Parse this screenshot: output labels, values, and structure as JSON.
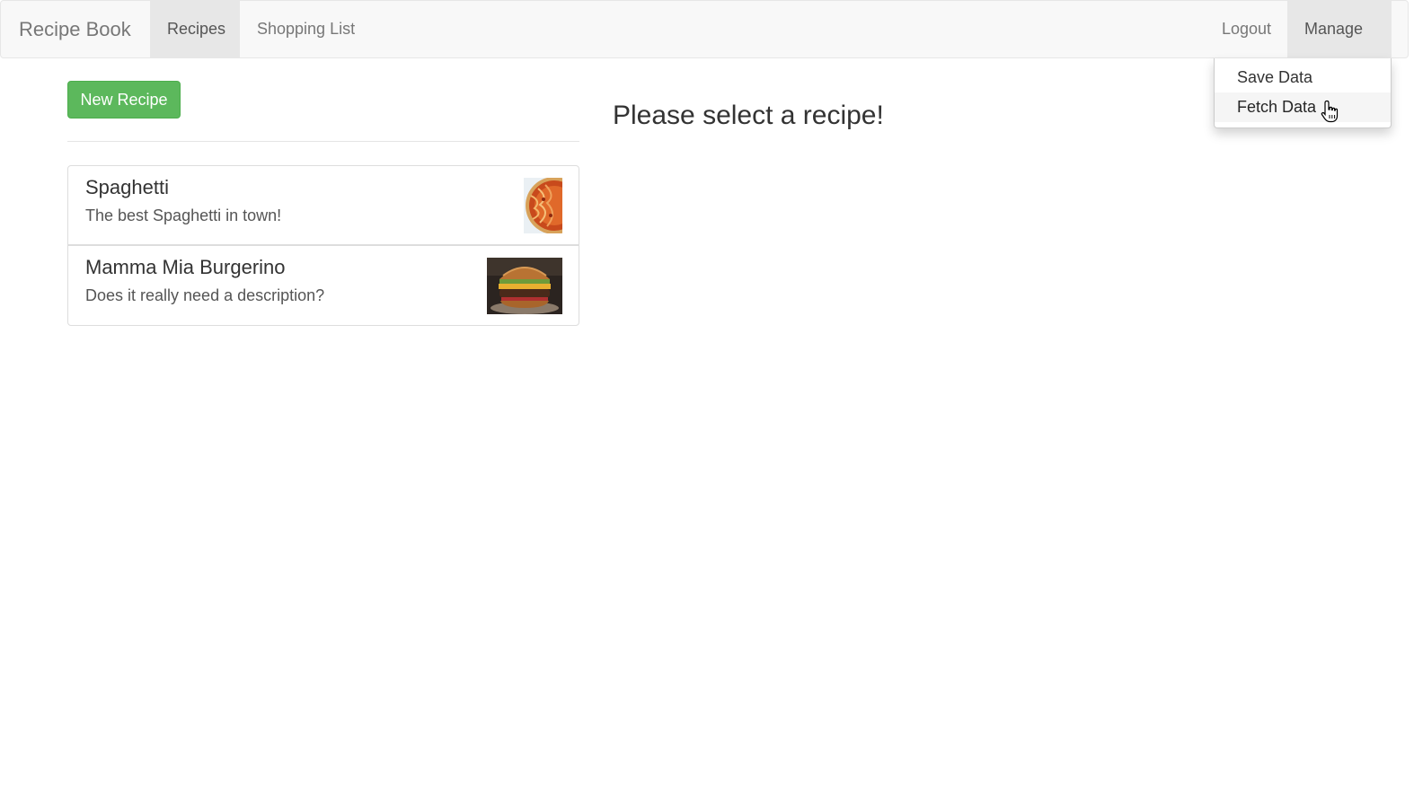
{
  "navbar": {
    "brand": "Recipe Book",
    "links": [
      "Recipes",
      "Shopping List"
    ],
    "active_link": "Recipes",
    "logout": "Logout",
    "manage": "Manage"
  },
  "manage_menu": {
    "items": [
      "Save Data",
      "Fetch Data"
    ],
    "hovered_item": "Fetch Data"
  },
  "recipes": {
    "new_button": "New Recipe",
    "list": [
      {
        "name": "Spaghetti",
        "description": "The best Spaghetti in town!"
      },
      {
        "name": "Mamma Mia Burgerino",
        "description": "Does it really need a description?"
      }
    ]
  },
  "detail": {
    "placeholder": "Please select a recipe!"
  },
  "colors": {
    "success": "#5cb85c",
    "navbar_bg": "#f8f8f8",
    "active_nav_bg": "#e7e7e7"
  }
}
